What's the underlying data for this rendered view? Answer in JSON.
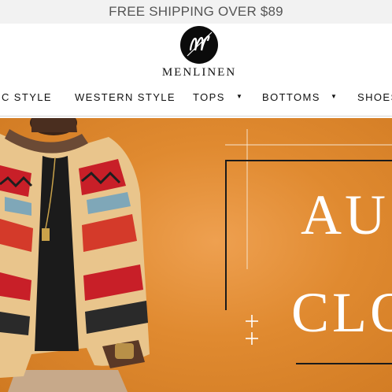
{
  "promo_bar": {
    "text": "FREE SHIPPING OVER $89"
  },
  "logo": {
    "monogram": "M",
    "name": "MENLINEN"
  },
  "nav": {
    "items": [
      {
        "label": "IC STYLE",
        "has_dropdown": false
      },
      {
        "label": "WESTERN STYLE",
        "has_dropdown": false
      },
      {
        "label": "TOPS",
        "has_dropdown": true
      },
      {
        "label": "BOTTOMS",
        "has_dropdown": true
      },
      {
        "label": "SHOES",
        "has_dropdown": false
      }
    ]
  },
  "hero": {
    "line1": "AU",
    "line2": "CLO",
    "background_color": "#e08a30",
    "frame_color": "#1a1a1a"
  }
}
